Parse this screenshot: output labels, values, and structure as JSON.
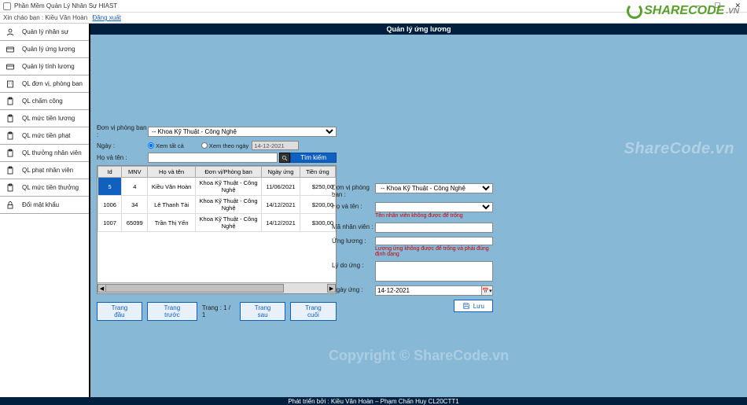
{
  "window": {
    "title": "Phần Mềm Quản Lý Nhân Sự HIAST"
  },
  "userbar": {
    "greeting": "Xin chào bạn :",
    "username": "Kiều Văn Hoàn",
    "logout": "Đăng xuất"
  },
  "sidebar": {
    "items": [
      {
        "label": "Quản lý nhân sự"
      },
      {
        "label": "Quản lý ứng lương"
      },
      {
        "label": "Quản lý tính lương"
      },
      {
        "label": "QL đơn vị, phòng ban"
      },
      {
        "label": "QL chấm công"
      },
      {
        "label": "QL mức tiền lương"
      },
      {
        "label": "QL mức tiền phạt"
      },
      {
        "label": "QL thưởng nhân viên"
      },
      {
        "label": "QL phạt nhân viên"
      },
      {
        "label": "QL mức tiền thưởng"
      },
      {
        "label": "Đổi mật khẩu"
      }
    ]
  },
  "page_title": "Quản lý ứng lương",
  "filters": {
    "dept_label": "Đơn vị phòng ban :",
    "dept_value": "-- Khoa Kỹ Thuật - Công Nghệ",
    "day_label": "Ngày :",
    "radio_all": "Xem tất cả",
    "radio_byday": "Xem theo ngày",
    "date_value": "14-12-2021",
    "name_label": "Họ và tên :",
    "name_value": "",
    "search_btn": "Tìm kiếm"
  },
  "grid": {
    "headers": [
      "Id",
      "MNV",
      "Họ và tên",
      "Đơn vị/Phòng ban",
      "Ngày ứng",
      "Tiền ứng"
    ],
    "rows": [
      {
        "id": "5",
        "mnv": "4",
        "name": "Kiều Văn Hoàn",
        "dept": "Khoa Kỹ Thuật - Công Nghệ",
        "date": "11/06/2021",
        "amount": "$250,00"
      },
      {
        "id": "1006",
        "mnv": "34",
        "name": "Lê Thanh Tài",
        "dept": "Khoa Kỹ Thuật - Công Nghệ",
        "date": "14/12/2021",
        "amount": "$200,00"
      },
      {
        "id": "1007",
        "mnv": "65099",
        "name": "Trần Thị Yến",
        "dept": "Khoa Kỹ Thuật - Công Nghệ",
        "date": "14/12/2021",
        "amount": "$300,00"
      }
    ]
  },
  "pager": {
    "first": "Trang đầu",
    "prev": "Trang trước",
    "label": "Trang :",
    "pos": "1 / 1",
    "next": "Trang sau",
    "last": "Trang cuối"
  },
  "form": {
    "dept_label": "Đơn vị phòng ban :",
    "dept_value": "-- Khoa Kỹ Thuật - Công Nghệ",
    "name_label": "Họ và tên :",
    "name_value": "",
    "empid_label": "Mã nhân viên :",
    "empid_value": "",
    "err_name": "Tên nhân viên không được để trống",
    "advance_label": "Ứng lương :",
    "advance_value": "",
    "err_advance": "Lương ứng không được để trống và phải đúng định dạng",
    "reason_label": "Lý do ứng :",
    "reason_value": "",
    "date_label": "Ngày ứng :",
    "date_value": "14-12-2021",
    "save": "Lưu"
  },
  "watermarks": {
    "big": "ShareCode.vn",
    "copy": "Copyright © ShareCode.vn",
    "logo_text": "SHARECODE",
    "logo_vn": ".VN"
  },
  "footer": "Phát triển bởi : Kiều Văn Hoàn – Phạm Chấn Huy CL20CTT1"
}
